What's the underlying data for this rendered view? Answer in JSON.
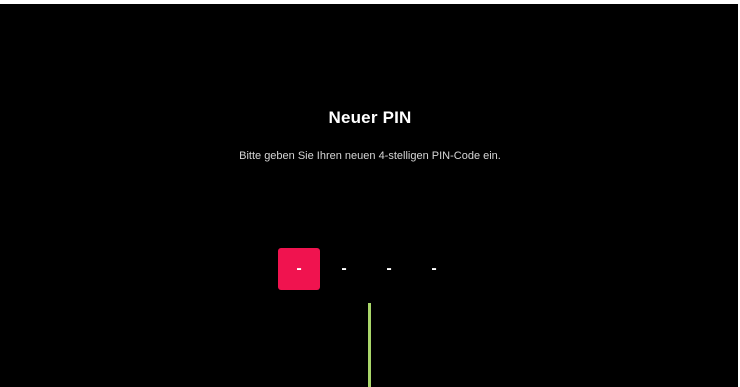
{
  "dialog": {
    "title": "Neuer PIN",
    "subtitle": "Bitte geben Sie Ihren neuen 4-stelligen PIN-Code ein."
  },
  "pin": {
    "digits": [
      "-",
      "-",
      "-",
      "-"
    ],
    "active_index": 0,
    "active_color": "#f0134f"
  },
  "colors": {
    "background": "#000000",
    "text": "#ffffff",
    "focus_indicator": "#a9d66a"
  }
}
